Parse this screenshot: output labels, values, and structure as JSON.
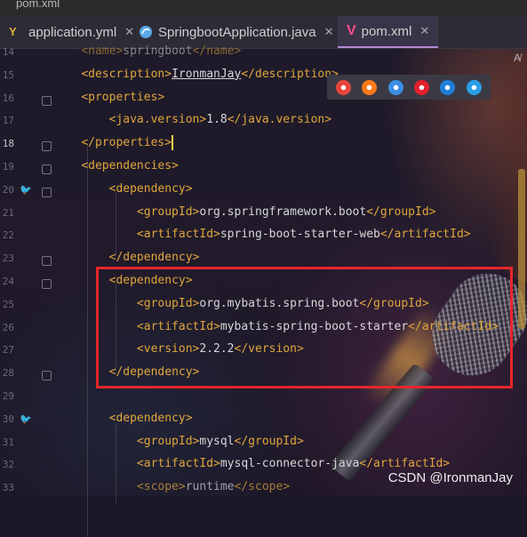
{
  "top_strip": {
    "text": "pom.xml"
  },
  "tabs": [
    {
      "label": "application.yml",
      "icon": "yaml-file-icon",
      "close": "✕"
    },
    {
      "label": "SpringbootApplication.java",
      "icon": "java-class-icon",
      "close": "✕"
    },
    {
      "label": "pom.xml",
      "icon": "maven-pom-icon",
      "close": "✕",
      "active": true
    }
  ],
  "line_numbers": [
    "14",
    "15",
    "16",
    "17",
    "18",
    "19",
    "20",
    "21",
    "22",
    "23",
    "24",
    "25",
    "26",
    "27",
    "28",
    "29",
    "30",
    "31",
    "32",
    "33"
  ],
  "current_line": "18",
  "code": [
    {
      "pre": "    ",
      "open": "<name>",
      "text": "springboot",
      "close": "</name>"
    },
    {
      "pre": "    ",
      "open": "<description>",
      "text": "IronmanJay",
      "close": "</description>"
    },
    {
      "pre": "    ",
      "open": "<properties>",
      "text": "",
      "close": ""
    },
    {
      "pre": "        ",
      "open": "<java.version>",
      "text": "1.8",
      "close": "</java.version>"
    },
    {
      "pre": "    ",
      "open": "</properties>",
      "text": "",
      "close": ""
    },
    {
      "pre": "    ",
      "open": "<dependencies>",
      "text": "",
      "close": ""
    },
    {
      "pre": "        ",
      "open": "<dependency>",
      "text": "",
      "close": ""
    },
    {
      "pre": "            ",
      "open": "<groupId>",
      "text": "org.springframework.boot",
      "close": "</groupId>"
    },
    {
      "pre": "            ",
      "open": "<artifactId>",
      "text": "spring-boot-starter-web",
      "close": "</artifactId>"
    },
    {
      "pre": "        ",
      "open": "</dependency>",
      "text": "",
      "close": ""
    },
    {
      "pre": "        ",
      "open": "<dependency>",
      "text": "",
      "close": ""
    },
    {
      "pre": "            ",
      "open": "<groupId>",
      "text": "org.mybatis.spring.boot",
      "close": "</groupId>"
    },
    {
      "pre": "            ",
      "open": "<artifactId>",
      "text": "mybatis-spring-boot-starter",
      "close": "</artifactId>"
    },
    {
      "pre": "            ",
      "open": "<version>",
      "text": "2.2.2",
      "close": "</version>"
    },
    {
      "pre": "        ",
      "open": "</dependency>",
      "text": "",
      "close": ""
    },
    {
      "pre": "",
      "open": "",
      "text": "",
      "close": ""
    },
    {
      "pre": "        ",
      "open": "<dependency>",
      "text": "",
      "close": ""
    },
    {
      "pre": "            ",
      "open": "<groupId>",
      "text": "mysql",
      "close": "</groupId>"
    },
    {
      "pre": "            ",
      "open": "<artifactId>",
      "text": "mysql-connector-java",
      "close": "</artifactId>"
    },
    {
      "pre": "            ",
      "open": "<scope>",
      "text": "runtime",
      "close": "</scope>"
    }
  ],
  "browser_popup": {
    "icons": [
      "chrome-icon",
      "firefox-icon",
      "safari-icon",
      "opera-icon",
      "ie-icon",
      "edge-icon"
    ],
    "colors": [
      "#e8453c",
      "#ff7a1a",
      "#3a8ee6",
      "#e2202e",
      "#1e7fd8",
      "#2a9ee8"
    ]
  },
  "top_right_icon": "A̸",
  "watermark": "CSDN @IronmanJay",
  "colors": {
    "tag": "#e0a63c",
    "text": "#d7d7d7",
    "highlight_box": "#e8262b",
    "active_tab_underline": "#b48ad6"
  }
}
